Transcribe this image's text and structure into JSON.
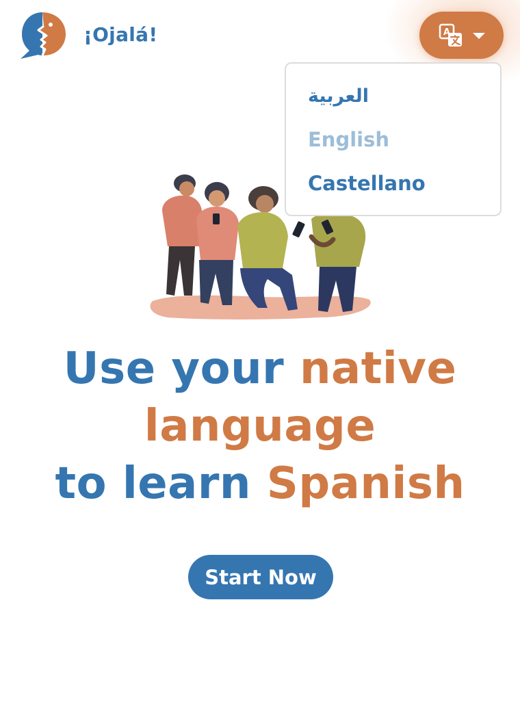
{
  "header": {
    "brand": "¡Ojalá!",
    "language_button": {
      "icon": "translate-icon",
      "caret": "caret-down-icon"
    }
  },
  "language_menu": {
    "items": [
      {
        "label": "العربية"
      },
      {
        "label": "English",
        "state": "selected-muted"
      },
      {
        "label": "Castellano"
      }
    ]
  },
  "hero": {
    "line1_a": "Use your ",
    "line1_b": "native",
    "line2": "language",
    "line3_a": "to learn ",
    "line3_b": "Spanish",
    "cta_label": "Start Now"
  },
  "colors": {
    "blue": "#3576b0",
    "orange": "#d07a45",
    "muted_blue": "#9dbdd8"
  }
}
